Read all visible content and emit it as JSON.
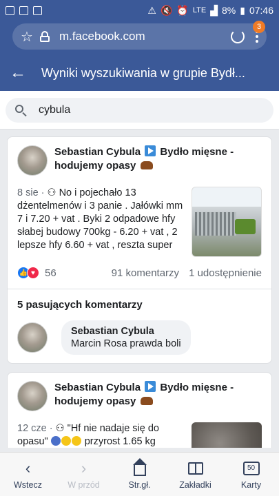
{
  "status_bar": {
    "network": "LTE",
    "battery": "8%",
    "time": "07:46"
  },
  "browser": {
    "url": "m.facebook.com",
    "badge_count": "3"
  },
  "header": {
    "title": "Wyniki wyszukiwania w grupie Bydł..."
  },
  "search": {
    "value": "cybula"
  },
  "posts": [
    {
      "author": "Sebastian Cybula",
      "group": "Bydło mięsne - hodujemy opasy",
      "date": "8 sie",
      "text": "No i pojechało 13 dżentelmenów i 3 panie . Jałówki mm 7 i 7.20 + vat . Byki 2 odpadowe hfy słabej budowy 700kg - 6.20 + vat , 2 lepsze hfy 6.60 + vat , reszta super hfy",
      "reactions": "56",
      "comments": "91 komentarzy",
      "shares": "1 udostępnienie",
      "matches_title": "5 pasujących komentarzy",
      "comment": {
        "author": "Sebastian Cybula",
        "text": "Marcin Rosa prawda boli"
      }
    },
    {
      "author": "Sebastian Cybula",
      "group": "Bydło mięsne - hodujemy opasy",
      "date": "12 cze",
      "text_part1": "\"Hf nie nadaje się do opasu\"",
      "text_part2": "przyrost 1.65 kg"
    }
  ],
  "bottom_nav": {
    "back": "Wstecz",
    "forward": "W przód",
    "home": "Str.gł.",
    "bookmarks": "Zakładki",
    "tabs": "Karty",
    "tabs_count": "50"
  }
}
